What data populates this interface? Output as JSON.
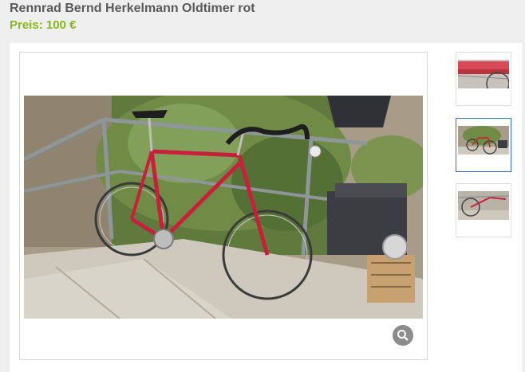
{
  "listing": {
    "title": "Rennrad Bernd Herkelmann Oldtimer rot",
    "price_label": "Preis:",
    "price_value": "100 €"
  },
  "gallery": {
    "thumbnail_count": 3,
    "selected_thumbnail": 2,
    "zoom_icon": "magnifier-icon"
  },
  "colors": {
    "title": "#5a5a5a",
    "price": "#86b817",
    "bike_frame": "#c8203a",
    "selected_border": "#2a6fd6",
    "zoom_button": "#8c8c8c"
  }
}
